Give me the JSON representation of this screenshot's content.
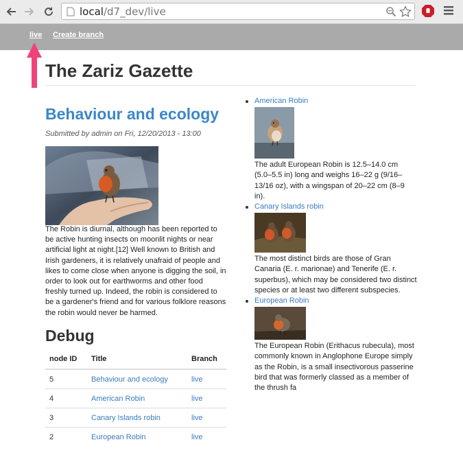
{
  "browser": {
    "url_host": "local",
    "url_path": "/d7_dev/live"
  },
  "toolbar": {
    "links": [
      "live",
      "Create branch"
    ]
  },
  "site": {
    "title": "The Zariz Gazette"
  },
  "node": {
    "title": "Behaviour and ecology",
    "submitted": "Submitted by admin on Fri, 12/20/2013 - 13:00",
    "body": "The Robin is diurnal, although has been reported to be active hunting insects on moonlit nights or near artificial light at night.[12] Well known to British and Irish gardeners, it is relatively unafraid of people and likes to come close when anyone is digging the soil, in order to look out for earthworms and other food freshly turned up. Indeed, the robin is considered to be a gardener's friend and for various folklore reasons the robin would never be harmed."
  },
  "debug": {
    "title": "Debug",
    "columns": [
      "node ID",
      "Title",
      "Branch"
    ],
    "rows": [
      {
        "id": "5",
        "title": "Behaviour and ecology",
        "branch": "live"
      },
      {
        "id": "4",
        "title": "American Robin",
        "branch": "live"
      },
      {
        "id": "3",
        "title": "Canary Islands robin",
        "branch": "live"
      },
      {
        "id": "2",
        "title": "European Robin",
        "branch": "live"
      }
    ]
  },
  "sidebar": {
    "items": [
      {
        "title": "American Robin",
        "text": "The adult European Robin is 12.5–14.0 cm (5.0–5.5 in) long and weighs 16–22 g (9/16–13/16 oz), with a wingspan of 20–22 cm (8–9 in)."
      },
      {
        "title": "Canary Islands robin",
        "text": "The most distinct birds are those of Gran Canaria (E. r. marionae) and Tenerife (E. r. superbus), which may be considered two distinct species or at least two different subspecies."
      },
      {
        "title": "European Robin",
        "text": "The European Robin (Erithacus rubecula), most commonly known in Anglophone Europe simply as the Robin, is a small insectivorous passerine bird that was formerly classed as a member of the thrush fa"
      }
    ]
  },
  "colors": {
    "link": "#3b7bbf",
    "toolbar": "#aaaaaa",
    "annotation_arrow": "#f0427a"
  }
}
